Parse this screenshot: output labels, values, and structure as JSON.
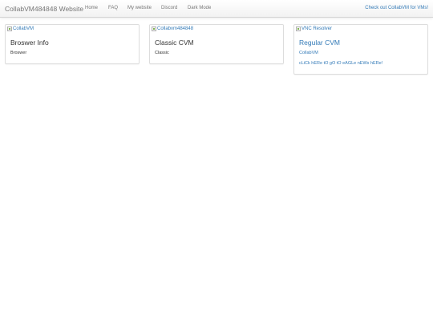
{
  "navbar": {
    "brand": "CollabVM484848 Website",
    "links": [
      "Home",
      "FAQ",
      "My website",
      "Discord",
      "Dark Mode"
    ],
    "right_link": "Check out CollabVM for VMs!"
  },
  "cards": [
    {
      "img_alt": "CollabVM",
      "title": "Broswer Info",
      "text": "Broswer"
    },
    {
      "img_alt": "Collabvm484848",
      "title": "Classic CVM",
      "text": "Classic"
    },
    {
      "img_alt": "VNC Resolver",
      "title": "Regular CVM",
      "text": "CollabVM",
      "text2": "cLiCk hERe tO gO tO eAGLe nEWs hERe!"
    }
  ],
  "colors": {
    "link": "#337ab7",
    "text": "#333333",
    "muted": "#777777"
  },
  "icons": {
    "card_image": "broken-image-icon"
  }
}
